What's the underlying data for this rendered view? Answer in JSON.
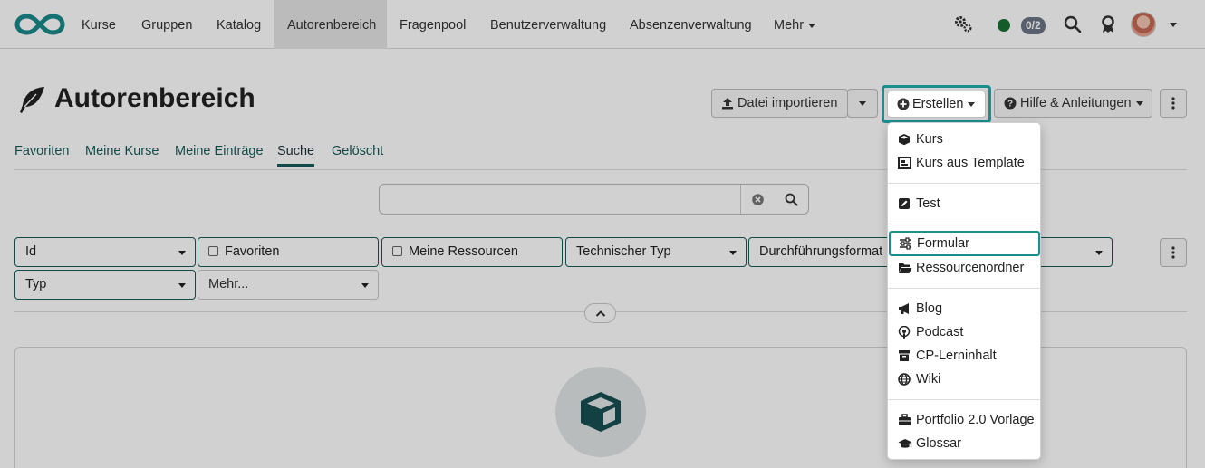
{
  "nav": {
    "items": [
      "Kurse",
      "Gruppen",
      "Katalog",
      "Autorenbereich",
      "Fragenpool",
      "Benutzerverwaltung",
      "Absenzenverwaltung",
      "Mehr"
    ],
    "active": "Autorenbereich",
    "badge": "0/2"
  },
  "page": {
    "title": "Autorenbereich",
    "import_label": "Datei importieren",
    "create_label": "Erstellen",
    "help_label": "Hilfe & Anleitungen"
  },
  "tabs": [
    "Favoriten",
    "Meine Kurse",
    "Meine Einträge",
    "Suche",
    "Gelöscht"
  ],
  "active_tab": "Suche",
  "search": {
    "value": "",
    "placeholder": ""
  },
  "filters": {
    "row1": [
      "Id",
      "Favoriten",
      "Meine Ressourcen",
      "Technischer Typ",
      "Durchführungsformat"
    ],
    "row2": [
      "Typ",
      "Mehr..."
    ]
  },
  "create_menu": {
    "groups": [
      [
        "Kurs",
        "Kurs aus Template"
      ],
      [
        "Test"
      ],
      [
        "Formular",
        "Ressourcenordner"
      ],
      [
        "Blog",
        "Podcast",
        "CP-Lerninhalt",
        "Wiki"
      ],
      [
        "Portfolio 2.0 Vorlage",
        "Glossar"
      ]
    ],
    "highlighted": "Formular"
  },
  "colors": {
    "accent": "#185a5a",
    "highlight": "#1a8f8f",
    "logo": "#1a8a8a"
  }
}
